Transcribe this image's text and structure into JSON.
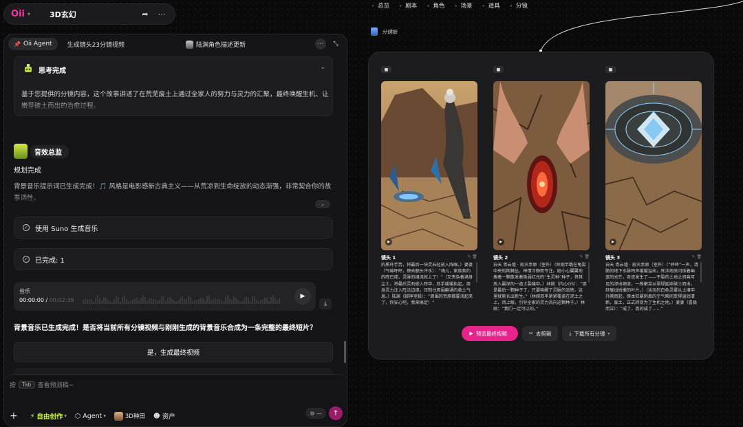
{
  "app": {
    "logo": "Oii",
    "project_title": "3D玄幻",
    "share_icon": "share-icon",
    "more_icon": "more-icon"
  },
  "chat": {
    "agent_label": "Oii Agent",
    "task_title": "生成镜头23分镜视频",
    "center_label": "陆渊角色描述更新",
    "think": {
      "title": "思考完成",
      "text": "基于您提供的分镜内容，这个故事讲述了在荒芜废土上通过全家人的努力与灵力的汇聚，最终唤醒生机、让嫩芽破土而出的治愈过程。"
    },
    "sfx": {
      "badge": "音效总监",
      "status": "规划完成",
      "text": "背景音乐提示词已生成完成！🎵 风格是电影感新古典主义——从荒凉到生命绽放的动态渐强，非常契合你的故事调性。"
    },
    "steps": [
      {
        "label": "使用 Suno 生成音乐"
      },
      {
        "label": "已完成: 1"
      }
    ],
    "audio": {
      "name": "音乐",
      "current": "00:00:00",
      "sep": " / ",
      "duration": "00:02:39"
    },
    "question": "背景音乐已生成完成！是否将当前所有分镜视频与刚刚生成的背景音乐合成为一条完整的最终短片？",
    "confirm_label": "是，生成最终视频",
    "composer": {
      "press": "按",
      "key": "Tab",
      "placeholder": "查看预测稿~",
      "plus": "+",
      "mode": "自由创作",
      "agent": "Agent",
      "style": "3D种田",
      "assets": "资产"
    }
  },
  "topnav": [
    "总览",
    "剧本",
    "角色",
    "场景",
    "道具",
    "分镜"
  ],
  "board": {
    "label": "分镜板",
    "shots": [
      {
        "title": "镜头 1",
        "desc": "的质朴手势，将最后一块灵石轻放入阵眼。）婆婆（气喘吁吁，擦去额头汗水）：“嗨儿，家族契约的阵已成，灵脉的缝流就上了！”（又夹杂着满身尘土，将最后灵石嵌入阵中，双手缓缓抬起，周身灵力注入阵法边缘，压制住周围翻涌的黄土气息。）陆渊（脚神坚毅）：“周围的荒原都要活起来了，你安心吧，我来搞定！”"
      },
      {
        "title": "镜头 2",
        "desc": "白天 青云墟 · 寂灭赤原（室外）（林婉半跪在龟裂中央的荆棘丛，神情冷静而专注。她小心翼翼地捧着一颗散发着微弱红光的“生灵种”种子，将其放入最深的一道土裂缝中。）林婉（内心OS）：“那是最后一颗种子了，只要唤醒了灵脉的流转，这里就能长出新生。”（林婉双手紧紧覆盖在泥土之上，闭上眼，引导全家的灵力流向这颗种子。）林婉：“我们一定可以的。”"
      },
      {
        "title": "镜头 3",
        "desc": "白天 青云墟 · 寂灭赤原（室外）（“砰咚”一声，清脆的地下水脉鸣声缓缓溢出，阵法地底闪烁着幽蓝的光芒，奇迹发生了——干裂的土地之间竟可见的渗出细流，一株嫩芽从翠绿延续破土而出，舒展出娇嫩的叶片。）（淡淡的白色灵雾从土壤中升腾而起，原本狂暴刺鼻的空气瞬间变得温润清新。废土，正式转变为了生机之地。）婆婆（喜极而泣）：“成了，真的成了……”"
      }
    ],
    "actions": {
      "preview": "预览最终视频",
      "edit": "去剪辑",
      "download": "下载所有分镜"
    }
  },
  "colors": {
    "accent": "#e8238c",
    "brand": "#ff2fa8",
    "highlight": "#c6f04a"
  }
}
